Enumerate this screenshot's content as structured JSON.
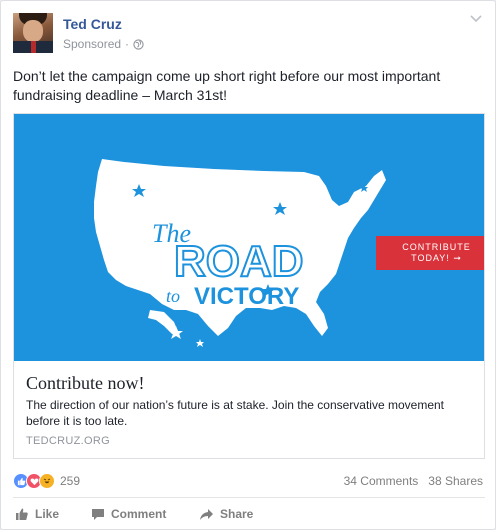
{
  "post": {
    "author": "Ted Cruz",
    "sponsored_label": "Sponsored",
    "separator": "·",
    "text": "Don’t let the campaign come up short right before our most important fundraising deadline – March 31st!"
  },
  "link": {
    "banner_alt_lines": [
      "The",
      "ROAD",
      "to",
      "VICTORY"
    ],
    "cta_line1": "CONTRIBUTE",
    "cta_line2": "TODAY! ➞",
    "title": "Contribute now!",
    "description": "The direction of our nation’s future is at stake. Join the conservative movement before it is too late.",
    "domain": "TEDCRUZ.ORG"
  },
  "engagement": {
    "reaction_count": "259",
    "comments": "34 Comments",
    "shares": "38 Shares"
  },
  "actions": {
    "like": "Like",
    "comment": "Comment",
    "share": "Share"
  },
  "colors": {
    "banner_blue": "#1d92dd",
    "cta_red": "#d9323a",
    "name_blue": "#365899"
  }
}
